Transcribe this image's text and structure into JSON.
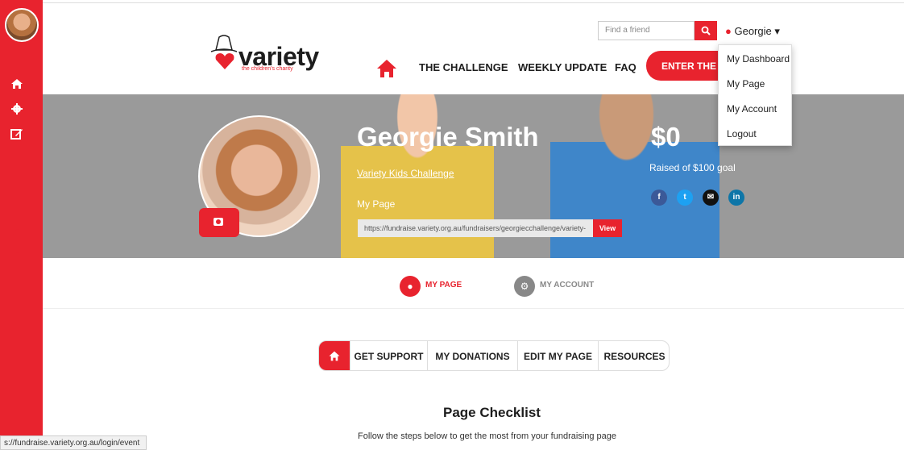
{
  "header": {
    "logo_word": "variety",
    "logo_sub": "the children's charity",
    "find_placeholder": "Find a friend",
    "user_name": "Georgie ▾"
  },
  "nav": {
    "items": [
      "THE CHALLENGE",
      "WEEKLY UPDATE",
      "FAQ"
    ],
    "enter_label": "ENTER THE CHALLENGE"
  },
  "dropdown": {
    "items": [
      "My Dashboard",
      "My Page",
      "My Account",
      "Logout"
    ]
  },
  "banner": {
    "name": "Georgie Smith",
    "event": "Variety Kids Challenge",
    "my_page_label": "My Page",
    "url": "https://fundraise.variety.org.au/fundraisers/georgiecchallenge/variety-",
    "view_label": "View",
    "amount": "$0",
    "raised": "Raised of $100 goal",
    "social": [
      "f",
      "t",
      "✉",
      "in"
    ]
  },
  "tabs": {
    "my_page": "MY PAGE",
    "my_account": "MY ACCOUNT"
  },
  "subnav": {
    "items": [
      "GET SUPPORT",
      "MY DONATIONS",
      "EDIT MY PAGE",
      "RESOURCES"
    ]
  },
  "checklist": {
    "title": "Page Checklist",
    "subtitle": "Follow the steps below to get the most from your fundraising page"
  },
  "status_url": "s://fundraise.variety.org.au/login/event",
  "colors": {
    "brand_red": "#e8232e",
    "facebook": "#3b5998",
    "twitter": "#1da1f2",
    "linkedin": "#0e76a8"
  }
}
